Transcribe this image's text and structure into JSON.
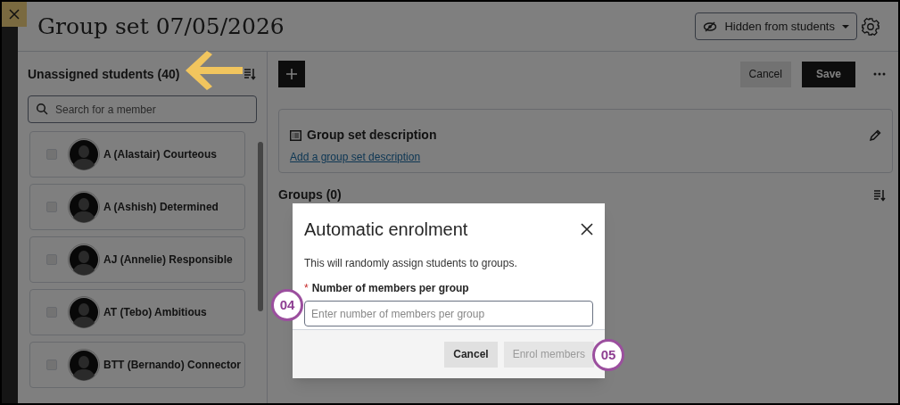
{
  "header": {
    "title": "Group set 07/05/2026",
    "visibility": "Hidden from students"
  },
  "unassigned": {
    "title": "Unassigned students (40)",
    "search_placeholder": "Search for a member",
    "students": [
      {
        "name": "A (Alastair) Courteous",
        "checked": false
      },
      {
        "name": "A (Ashish) Determined",
        "checked": false
      },
      {
        "name": "AJ (Annelie) Responsible",
        "checked": false
      },
      {
        "name": "AT (Tebo) Ambitious",
        "checked": false
      },
      {
        "name": "BTT (Bernando) Connector",
        "checked": false
      }
    ]
  },
  "toolbar": {
    "buttons": [
      {
        "label": "Cancel",
        "kind": "secondary"
      },
      {
        "label": "Save",
        "kind": "primary"
      }
    ]
  },
  "description": {
    "title": "Group set description",
    "link": "Add a group set description"
  },
  "groups": {
    "title": "Groups (0)"
  },
  "dialog": {
    "title": "Automatic enrolment",
    "text": "This will randomly assign students to groups.",
    "required_mark": "*",
    "field_label": "Number of members per group",
    "placeholder": "Enter number of members per group",
    "buttons": [
      {
        "label": "Cancel",
        "disabled": false
      },
      {
        "label": "Enrol members",
        "disabled": true
      }
    ]
  },
  "annotations": [
    {
      "label": "04"
    },
    {
      "label": "05"
    }
  ]
}
